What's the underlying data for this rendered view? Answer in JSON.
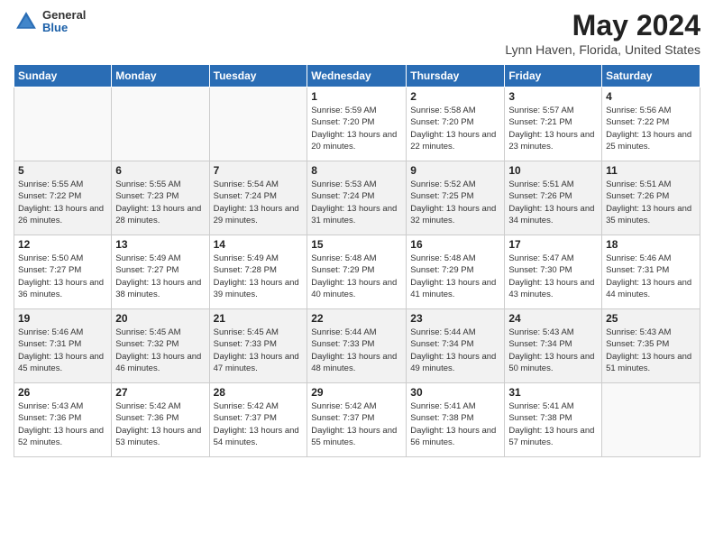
{
  "header": {
    "logo_general": "General",
    "logo_blue": "Blue",
    "month_title": "May 2024",
    "location": "Lynn Haven, Florida, United States"
  },
  "weekdays": [
    "Sunday",
    "Monday",
    "Tuesday",
    "Wednesday",
    "Thursday",
    "Friday",
    "Saturday"
  ],
  "weeks": [
    [
      {
        "day": "",
        "empty": true
      },
      {
        "day": "",
        "empty": true
      },
      {
        "day": "",
        "empty": true
      },
      {
        "day": "1",
        "sunrise": "5:59 AM",
        "sunset": "7:20 PM",
        "daylight": "13 hours and 20 minutes."
      },
      {
        "day": "2",
        "sunrise": "5:58 AM",
        "sunset": "7:20 PM",
        "daylight": "13 hours and 22 minutes."
      },
      {
        "day": "3",
        "sunrise": "5:57 AM",
        "sunset": "7:21 PM",
        "daylight": "13 hours and 23 minutes."
      },
      {
        "day": "4",
        "sunrise": "5:56 AM",
        "sunset": "7:22 PM",
        "daylight": "13 hours and 25 minutes."
      }
    ],
    [
      {
        "day": "5",
        "sunrise": "5:55 AM",
        "sunset": "7:22 PM",
        "daylight": "13 hours and 26 minutes."
      },
      {
        "day": "6",
        "sunrise": "5:55 AM",
        "sunset": "7:23 PM",
        "daylight": "13 hours and 28 minutes."
      },
      {
        "day": "7",
        "sunrise": "5:54 AM",
        "sunset": "7:24 PM",
        "daylight": "13 hours and 29 minutes."
      },
      {
        "day": "8",
        "sunrise": "5:53 AM",
        "sunset": "7:24 PM",
        "daylight": "13 hours and 31 minutes."
      },
      {
        "day": "9",
        "sunrise": "5:52 AM",
        "sunset": "7:25 PM",
        "daylight": "13 hours and 32 minutes."
      },
      {
        "day": "10",
        "sunrise": "5:51 AM",
        "sunset": "7:26 PM",
        "daylight": "13 hours and 34 minutes."
      },
      {
        "day": "11",
        "sunrise": "5:51 AM",
        "sunset": "7:26 PM",
        "daylight": "13 hours and 35 minutes."
      }
    ],
    [
      {
        "day": "12",
        "sunrise": "5:50 AM",
        "sunset": "7:27 PM",
        "daylight": "13 hours and 36 minutes."
      },
      {
        "day": "13",
        "sunrise": "5:49 AM",
        "sunset": "7:27 PM",
        "daylight": "13 hours and 38 minutes."
      },
      {
        "day": "14",
        "sunrise": "5:49 AM",
        "sunset": "7:28 PM",
        "daylight": "13 hours and 39 minutes."
      },
      {
        "day": "15",
        "sunrise": "5:48 AM",
        "sunset": "7:29 PM",
        "daylight": "13 hours and 40 minutes."
      },
      {
        "day": "16",
        "sunrise": "5:48 AM",
        "sunset": "7:29 PM",
        "daylight": "13 hours and 41 minutes."
      },
      {
        "day": "17",
        "sunrise": "5:47 AM",
        "sunset": "7:30 PM",
        "daylight": "13 hours and 43 minutes."
      },
      {
        "day": "18",
        "sunrise": "5:46 AM",
        "sunset": "7:31 PM",
        "daylight": "13 hours and 44 minutes."
      }
    ],
    [
      {
        "day": "19",
        "sunrise": "5:46 AM",
        "sunset": "7:31 PM",
        "daylight": "13 hours and 45 minutes."
      },
      {
        "day": "20",
        "sunrise": "5:45 AM",
        "sunset": "7:32 PM",
        "daylight": "13 hours and 46 minutes."
      },
      {
        "day": "21",
        "sunrise": "5:45 AM",
        "sunset": "7:33 PM",
        "daylight": "13 hours and 47 minutes."
      },
      {
        "day": "22",
        "sunrise": "5:44 AM",
        "sunset": "7:33 PM",
        "daylight": "13 hours and 48 minutes."
      },
      {
        "day": "23",
        "sunrise": "5:44 AM",
        "sunset": "7:34 PM",
        "daylight": "13 hours and 49 minutes."
      },
      {
        "day": "24",
        "sunrise": "5:43 AM",
        "sunset": "7:34 PM",
        "daylight": "13 hours and 50 minutes."
      },
      {
        "day": "25",
        "sunrise": "5:43 AM",
        "sunset": "7:35 PM",
        "daylight": "13 hours and 51 minutes."
      }
    ],
    [
      {
        "day": "26",
        "sunrise": "5:43 AM",
        "sunset": "7:36 PM",
        "daylight": "13 hours and 52 minutes."
      },
      {
        "day": "27",
        "sunrise": "5:42 AM",
        "sunset": "7:36 PM",
        "daylight": "13 hours and 53 minutes."
      },
      {
        "day": "28",
        "sunrise": "5:42 AM",
        "sunset": "7:37 PM",
        "daylight": "13 hours and 54 minutes."
      },
      {
        "day": "29",
        "sunrise": "5:42 AM",
        "sunset": "7:37 PM",
        "daylight": "13 hours and 55 minutes."
      },
      {
        "day": "30",
        "sunrise": "5:41 AM",
        "sunset": "7:38 PM",
        "daylight": "13 hours and 56 minutes."
      },
      {
        "day": "31",
        "sunrise": "5:41 AM",
        "sunset": "7:38 PM",
        "daylight": "13 hours and 57 minutes."
      },
      {
        "day": "",
        "empty": true
      }
    ]
  ],
  "labels": {
    "sunrise_prefix": "Sunrise: ",
    "sunset_prefix": "Sunset: ",
    "daylight_prefix": "Daylight: "
  }
}
